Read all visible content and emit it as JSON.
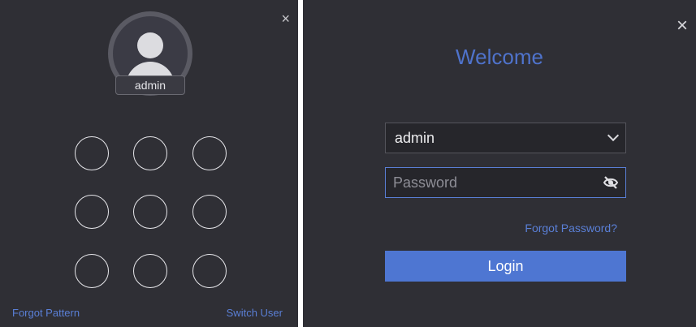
{
  "pattern_login": {
    "close_glyph": "×",
    "avatar": {
      "icon": "user-avatar-icon",
      "username": "admin"
    },
    "pattern_dots": 9,
    "forgot_pattern": "Forgot Pattern",
    "switch_user": "Switch User"
  },
  "password_login": {
    "close_glyph": "×",
    "title": "Welcome",
    "username_select": {
      "value": "admin",
      "icon": "chevron-down-icon"
    },
    "password": {
      "placeholder": "Password",
      "value": "",
      "toggle_icon": "eye-off-icon"
    },
    "forgot_password": "Forgot Password?",
    "login_button": "Login"
  },
  "colors": {
    "panel_bg": "#2f2f35",
    "accent": "#4e76d2",
    "link": "#5a7fd6"
  }
}
